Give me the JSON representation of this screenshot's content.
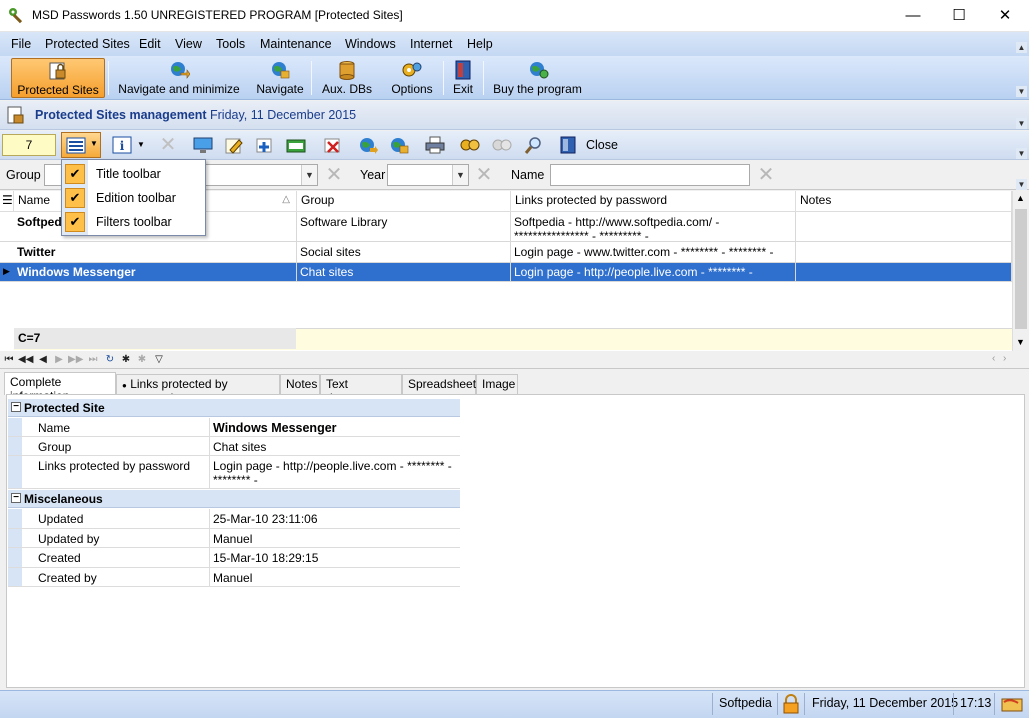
{
  "window": {
    "title": "MSD Passwords 1.50 UNREGISTERED PROGRAM [Protected Sites]",
    "minimize": "—",
    "maximize": "☐",
    "close": "✕"
  },
  "menu": [
    "File",
    "Protected Sites",
    "Edit",
    "View",
    "Tools",
    "Maintenance",
    "Windows",
    "Internet",
    "Help"
  ],
  "toolbar": {
    "protected_sites": "Protected Sites",
    "navigate_minimize": "Navigate and minimize",
    "navigate": "Navigate",
    "aux_dbs": "Aux. DBs",
    "options": "Options",
    "exit": "Exit",
    "buy": "Buy the program"
  },
  "heading": {
    "title": "Protected Sites management",
    "date": "Friday, 11 December 2015"
  },
  "edit_toolbar": {
    "counter": "7",
    "close": "Close"
  },
  "dropdown": {
    "items": [
      "Title toolbar",
      "Edition toolbar",
      "Filters toolbar"
    ]
  },
  "filters": {
    "group_label": "Group",
    "year_label": "Year",
    "name_label": "Name"
  },
  "grid": {
    "headers": [
      "Name",
      "Group",
      "Links protected by password",
      "Notes"
    ],
    "rows": [
      {
        "name": "Softpedia",
        "group": "Software Library",
        "links": "Softpedia - http://www.softpedia.com/ - **************** - ********* -",
        "notes": ""
      },
      {
        "name": "Twitter",
        "group": "Social sites",
        "links": "Login page - www.twitter.com - ******** - ******** -",
        "notes": ""
      },
      {
        "name": "Windows Messenger",
        "group": "Chat sites",
        "links": "Login page - http://people.live.com - ******** - ******** -",
        "notes": ""
      }
    ],
    "footer_count": "C=7"
  },
  "tabs": [
    "Complete information",
    "Links protected by password",
    "Notes",
    "Text document",
    "Spreadsheet",
    "Image"
  ],
  "detail": {
    "section1": "Protected Site",
    "section2": "Miscelaneous",
    "rows1": [
      {
        "k": "Name",
        "v": "Windows Messenger"
      },
      {
        "k": "Group",
        "v": "Chat sites"
      },
      {
        "k": "Links protected by password",
        "v": "Login page - http://people.live.com - ******** - ******** -"
      }
    ],
    "rows2": [
      {
        "k": "Updated",
        "v": "25-Mar-10 23:11:06"
      },
      {
        "k": "Updated by",
        "v": "Manuel"
      },
      {
        "k": "Created",
        "v": "15-Mar-10 18:29:15"
      },
      {
        "k": "Created by",
        "v": "Manuel"
      }
    ]
  },
  "status": {
    "site": "Softpedia",
    "date": "Friday, 11 December 2015",
    "time": "17:13"
  },
  "colors": {
    "selection": "#2f6fcd",
    "accent_orange": "#f59f2d",
    "heading_text": "#1a3c8c"
  }
}
